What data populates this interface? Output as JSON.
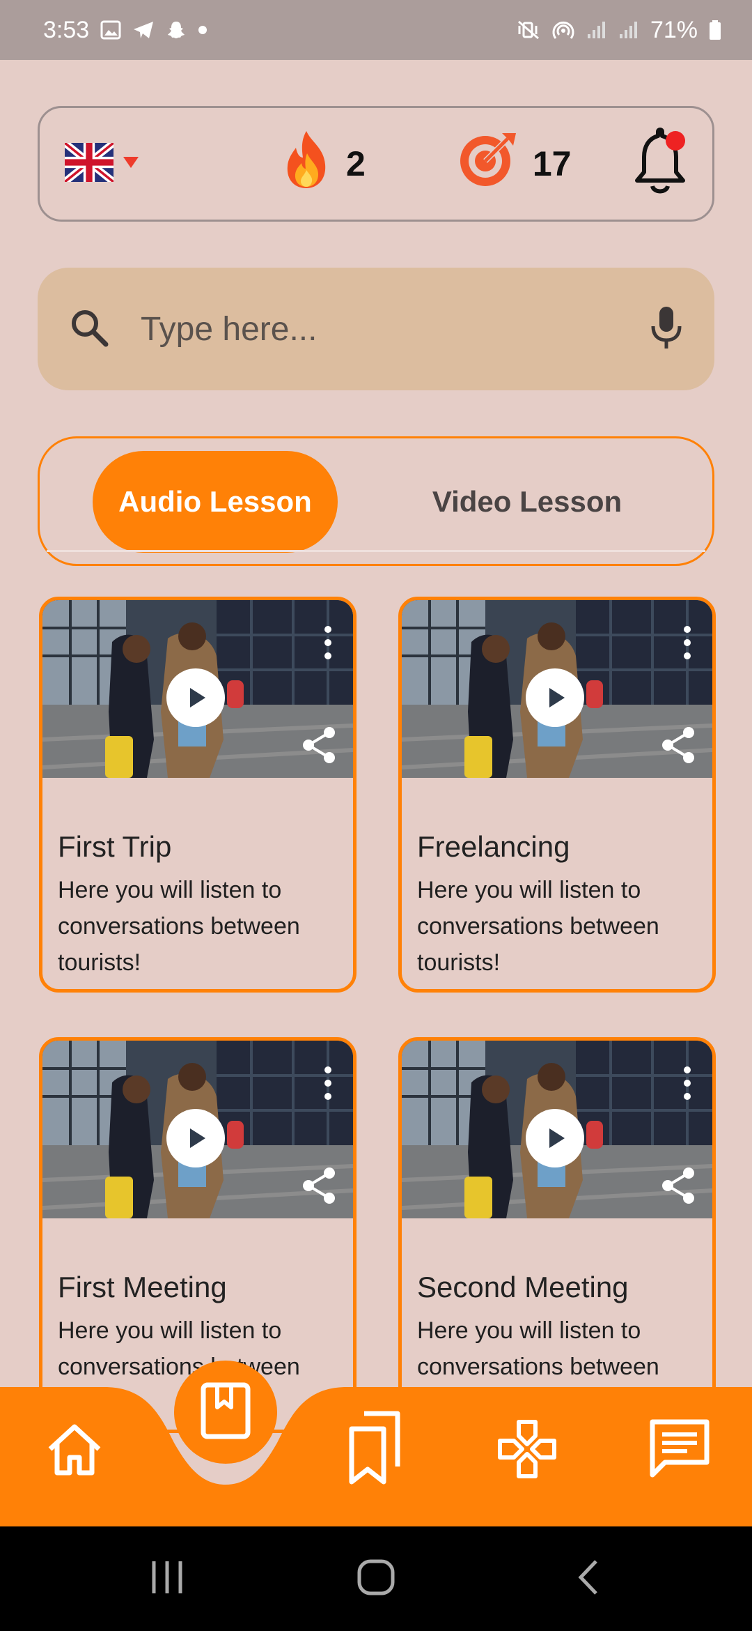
{
  "status_bar": {
    "time": "3:53",
    "battery": "71%",
    "icons_left": [
      "gallery-icon",
      "telegram-icon",
      "snapchat-icon",
      "dot-icon"
    ],
    "icons_right": [
      "mute-vibrate-icon",
      "hotspot-icon",
      "signal-icon",
      "signal-icon",
      "battery-icon"
    ]
  },
  "header": {
    "language_flag": "uk-flag-icon",
    "streak_count": "2",
    "target_count": "17",
    "notification_badge": true
  },
  "search": {
    "placeholder": "Type here..."
  },
  "tabs": {
    "active": "Audio Lesson",
    "inactive": "Video Lesson"
  },
  "lessons": [
    {
      "title": "First Trip",
      "description": "Here you will listen to conversations between tourists!"
    },
    {
      "title": "Freelancing",
      "description": "Here you will listen to conversations between tourists!"
    },
    {
      "title": "First Meeting",
      "description": "Here you will listen to conversations between"
    },
    {
      "title": "Second Meeting",
      "description": "Here you will listen to conversations between"
    }
  ],
  "bottom_nav": {
    "items": [
      "home-icon",
      "lesson-book-icon",
      "bookmarks-icon",
      "games-icon",
      "chat-icon"
    ],
    "active": "lesson-book-icon"
  },
  "colors": {
    "accent": "#ff8107",
    "background": "#e5cdc7",
    "search_bg": "#dcbd9f",
    "status_bar": "#ab9d9b"
  }
}
